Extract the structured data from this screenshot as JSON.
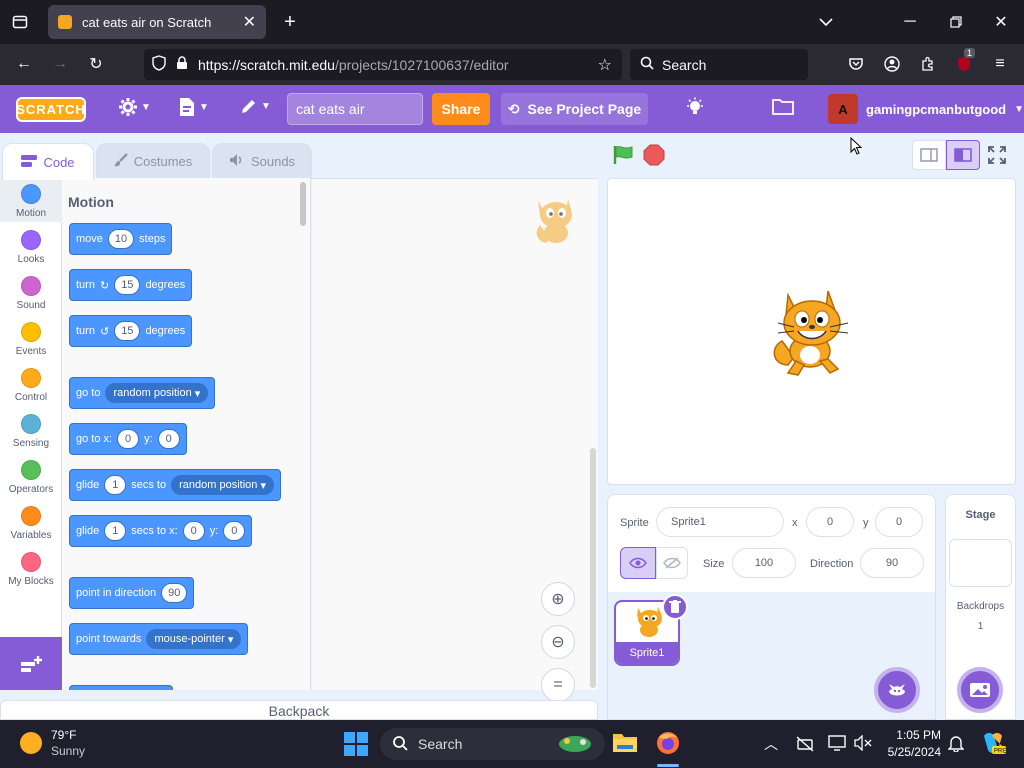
{
  "browser": {
    "tab_title": "cat eats air on Scratch",
    "url_host": "https://scratch.mit.edu",
    "url_path": "/projects/1027100637/editor",
    "search_placeholder": "Search",
    "ext_badge": "1"
  },
  "menubar": {
    "logo": "SCRATCH",
    "project_title": "cat eats air",
    "share_label": "Share",
    "see_project_label": "See Project Page",
    "username": "gamingpcmanbutgood",
    "avatar_letter": "A"
  },
  "editor_tabs": {
    "code": "Code",
    "costumes": "Costumes",
    "sounds": "Sounds"
  },
  "categories": [
    {
      "label": "Motion",
      "color": "#4c97ff"
    },
    {
      "label": "Looks",
      "color": "#9966ff"
    },
    {
      "label": "Sound",
      "color": "#cf63cf"
    },
    {
      "label": "Events",
      "color": "#ffbf00"
    },
    {
      "label": "Control",
      "color": "#ffab19"
    },
    {
      "label": "Sensing",
      "color": "#5cb1d6"
    },
    {
      "label": "Operators",
      "color": "#59c059"
    },
    {
      "label": "Variables",
      "color": "#ff8c1a"
    },
    {
      "label": "My Blocks",
      "color": "#ff6680"
    }
  ],
  "palette": {
    "heading": "Motion",
    "move": {
      "label": "move",
      "value": "10",
      "unit": "steps"
    },
    "turn_right": {
      "label": "turn",
      "value": "15",
      "unit": "degrees"
    },
    "turn_left": {
      "label": "turn",
      "value": "15",
      "unit": "degrees"
    },
    "goto": {
      "label": "go to",
      "option": "random position"
    },
    "goto_xy": {
      "label_x": "go to x:",
      "x": "0",
      "label_y": "y:",
      "y": "0"
    },
    "glide_random": {
      "label": "glide",
      "secs": "1",
      "label2": "secs to",
      "option": "random position"
    },
    "glide_xy": {
      "label": "glide",
      "secs": "1",
      "label2": "secs to x:",
      "x": "0",
      "label_y": "y:",
      "y": "0"
    },
    "point_direction": {
      "label": "point in direction",
      "value": "90"
    },
    "point_towards": {
      "label": "point towards",
      "option": "mouse-pointer"
    }
  },
  "backpack": "Backpack",
  "sprite_info": {
    "sprite_label": "Sprite",
    "sprite_name": "Sprite1",
    "x_label": "x",
    "x": "0",
    "y_label": "y",
    "y": "0",
    "size_label": "Size",
    "size": "100",
    "direction_label": "Direction",
    "direction": "90"
  },
  "sprite_list": [
    {
      "name": "Sprite1"
    }
  ],
  "stage_pane": {
    "title": "Stage",
    "backdrops_label": "Backdrops",
    "backdrops_count": "1"
  },
  "taskbar": {
    "temperature": "79°F",
    "weather": "Sunny",
    "search": "Search",
    "time": "1:05 PM",
    "date": "5/25/2024"
  }
}
